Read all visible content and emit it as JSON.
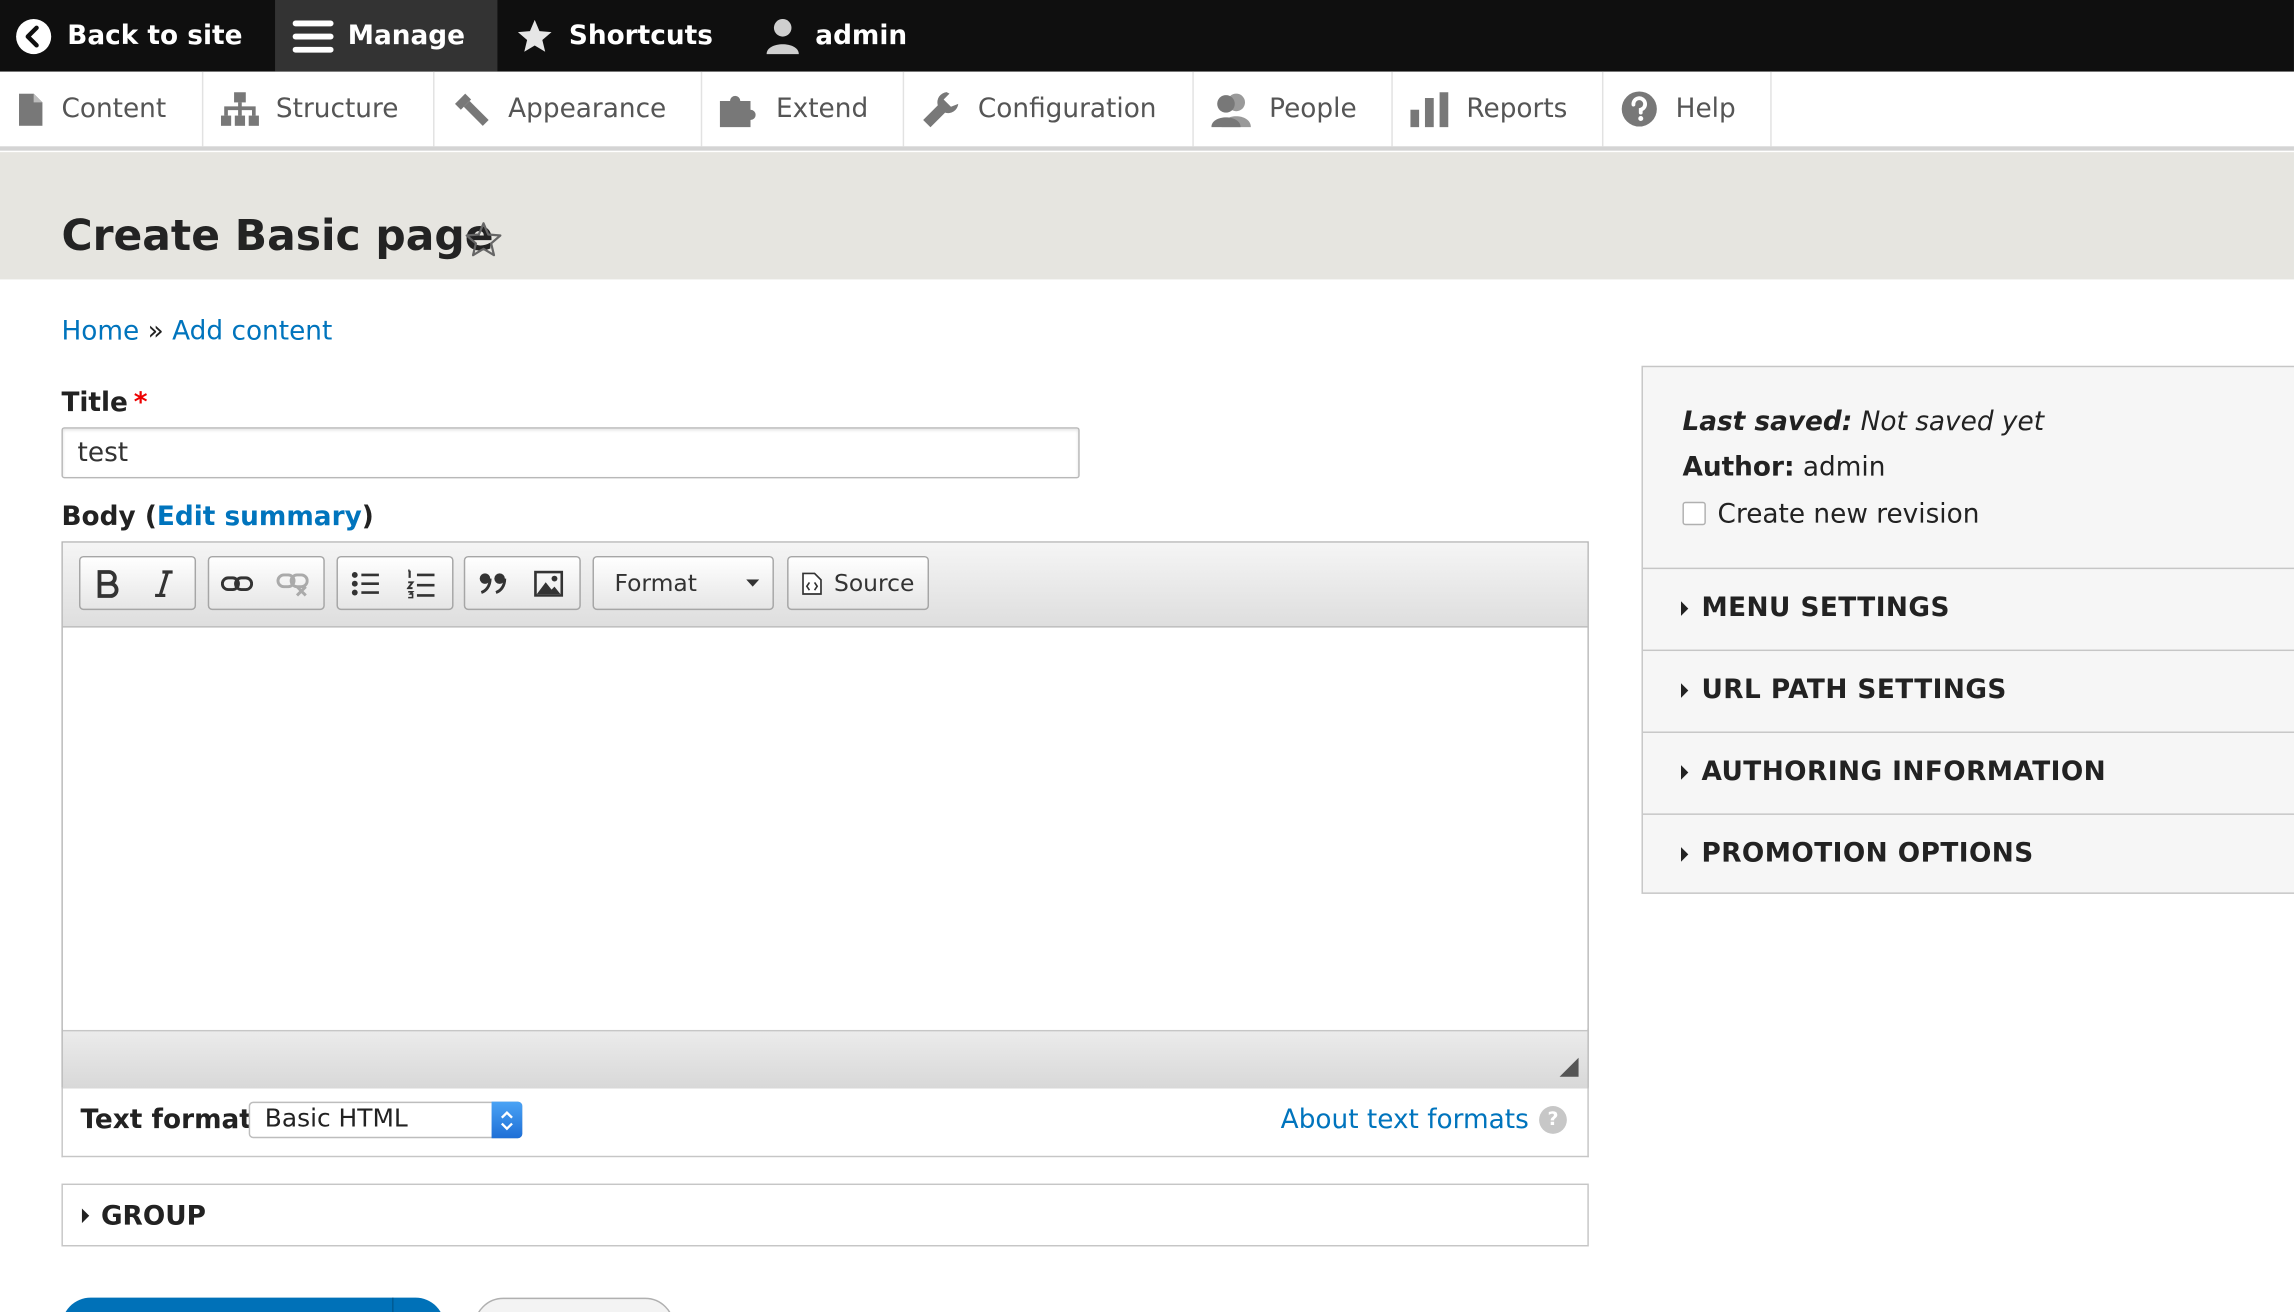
{
  "toolbar": {
    "back": "Back to site",
    "manage": "Manage",
    "shortcuts": "Shortcuts",
    "user": "admin"
  },
  "tray": {
    "content": "Content",
    "structure": "Structure",
    "appearance": "Appearance",
    "extend": "Extend",
    "configuration": "Configuration",
    "people": "People",
    "reports": "Reports",
    "help": "Help"
  },
  "page": {
    "title": "Create Basic page"
  },
  "breadcrumb": {
    "home": "Home",
    "separator": "»",
    "add_content": "Add content"
  },
  "form": {
    "title_label": "Title",
    "required_mark": "*",
    "title_value": "test",
    "body_label": "Body",
    "edit_summary": "Edit summary",
    "paren_open": "(",
    "paren_close": ")",
    "format_dropdown": "Format",
    "source_button": "Source",
    "text_format_label": "Text format",
    "text_format_value": "Basic HTML",
    "about_text_formats": "About text formats",
    "help_glyph": "?",
    "group_label": "GROUP"
  },
  "sidebar": {
    "last_saved_label": "Last saved:",
    "last_saved_value": "Not saved yet",
    "author_label": "Author:",
    "author_value": "admin",
    "revision_label": "Create new revision",
    "sections": [
      {
        "label": "MENU SETTINGS"
      },
      {
        "label": "URL PATH SETTINGS"
      },
      {
        "label": "AUTHORING INFORMATION"
      },
      {
        "label": "PROMOTION OPTIONS"
      }
    ]
  }
}
